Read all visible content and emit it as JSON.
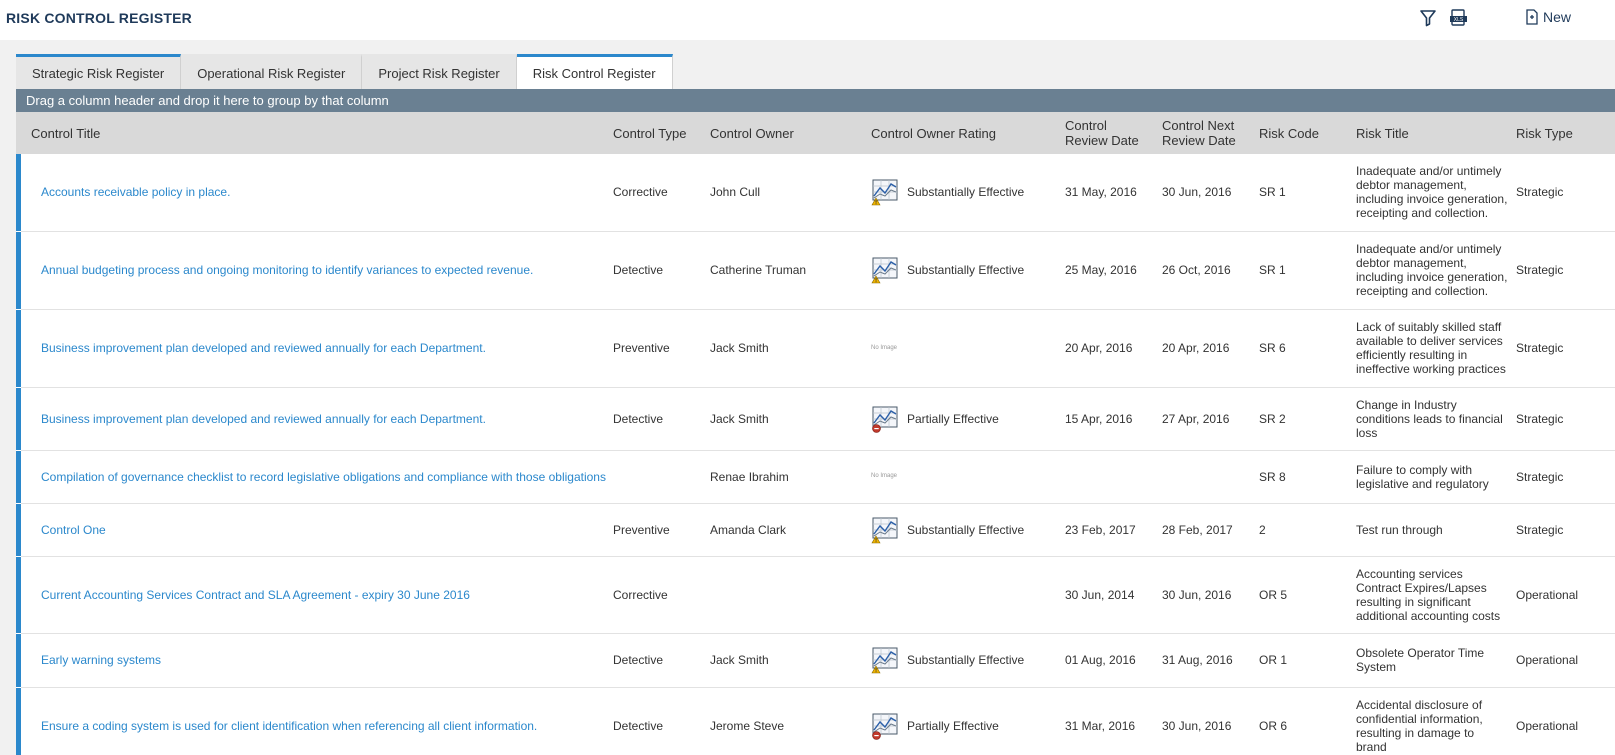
{
  "header": {
    "title": "RISK CONTROL REGISTER",
    "new_label": "New"
  },
  "tabs": [
    {
      "label": "Strategic Risk Register"
    },
    {
      "label": "Operational Risk Register"
    },
    {
      "label": "Project Risk Register"
    },
    {
      "label": "Risk Control Register"
    }
  ],
  "group_hint": "Drag a column header and drop it here to group by that column",
  "columns": {
    "control_title": "Control Title",
    "control_type": "Control Type",
    "control_owner": "Control Owner",
    "control_owner_rating": "Control Owner Rating",
    "review_date_1": "Control",
    "review_date_2": "Review Date",
    "next_review_1": "Control Next",
    "next_review_2": "Review Date",
    "risk_code": "Risk Code",
    "risk_title": "Risk Title",
    "risk_type": "Risk Type"
  },
  "no_image_text": "No Image",
  "rows": [
    {
      "title": "Accounts receivable policy in place.",
      "type": "Corrective",
      "owner": "John Cull",
      "rating": "Substantially Effective",
      "rating_icon": "warning",
      "review": "31 May, 2016",
      "next": "30 Jun, 2016",
      "code": "SR 1",
      "risk_title": "Inadequate and/or untimely debtor management, including invoice generation, receipting and collection.",
      "risk_type": "Strategic"
    },
    {
      "title": "Annual budgeting process and ongoing monitoring to identify variances to expected revenue.",
      "type": "Detective",
      "owner": "Catherine Truman",
      "rating": "Substantially Effective",
      "rating_icon": "warning",
      "review": "25 May, 2016",
      "next": "26 Oct, 2016",
      "code": "SR 1",
      "risk_title": "Inadequate and/or untimely debtor management, including invoice generation, receipting and collection.",
      "risk_type": "Strategic"
    },
    {
      "title": "Business improvement plan developed and reviewed annually for each Department.",
      "type": "Preventive",
      "owner": "Jack Smith",
      "rating": "",
      "rating_icon": "none",
      "review": "20 Apr, 2016",
      "next": "20 Apr, 2016",
      "code": "SR 6",
      "risk_title": "Lack of suitably skilled staff available to deliver services efficiently resulting in ineffective working practices",
      "risk_type": "Strategic"
    },
    {
      "title": "Business improvement plan developed and reviewed annually for each Department.",
      "type": "Detective",
      "owner": "Jack Smith",
      "rating": "Partially Effective",
      "rating_icon": "stop",
      "review": "15 Apr, 2016",
      "next": "27 Apr, 2016",
      "code": "SR 2",
      "risk_title": "Change in Industry conditions leads to financial loss",
      "risk_type": "Strategic"
    },
    {
      "title": "Compilation of governance checklist to record legislative obligations and compliance with those obligations",
      "type": "",
      "owner": "Renae Ibrahim",
      "rating": "",
      "rating_icon": "none",
      "review": "",
      "next": "",
      "code": "SR 8",
      "risk_title": "Failure to comply with legislative and regulatory",
      "risk_type": "Strategic"
    },
    {
      "title": "Control One",
      "type": "Preventive",
      "owner": "Amanda Clark",
      "rating": "Substantially Effective",
      "rating_icon": "warning",
      "review": "23 Feb, 2017",
      "next": "28 Feb, 2017",
      "code": "2",
      "risk_title": "Test run through",
      "risk_type": "Strategic"
    },
    {
      "title": "Current Accounting Services Contract and SLA Agreement - expiry 30 June 2016",
      "type": "Corrective",
      "owner": "",
      "rating": "",
      "rating_icon": "blank",
      "review": "30 Jun, 2014",
      "next": "30 Jun, 2016",
      "code": "OR 5",
      "risk_title": "Accounting services Contract Expires/Lapses resulting in significant additional accounting costs",
      "risk_type": "Operational"
    },
    {
      "title": "Early warning systems",
      "type": "Detective",
      "owner": "Jack Smith",
      "rating": "Substantially Effective",
      "rating_icon": "warning",
      "review": "01 Aug, 2016",
      "next": "31 Aug, 2016",
      "code": "OR 1",
      "risk_title": "Obsolete Operator Time System",
      "risk_type": "Operational"
    },
    {
      "title": "Ensure a coding system is used for client identification when referencing all client information.",
      "type": "Detective",
      "owner": "Jerome Steve",
      "rating": "Partially Effective",
      "rating_icon": "stop",
      "review": "31 Mar, 2016",
      "next": "30 Jun, 2016",
      "code": "OR 6",
      "risk_title": "Accidental disclosure of confidential information, resulting in damage to brand",
      "risk_type": "Operational"
    }
  ]
}
